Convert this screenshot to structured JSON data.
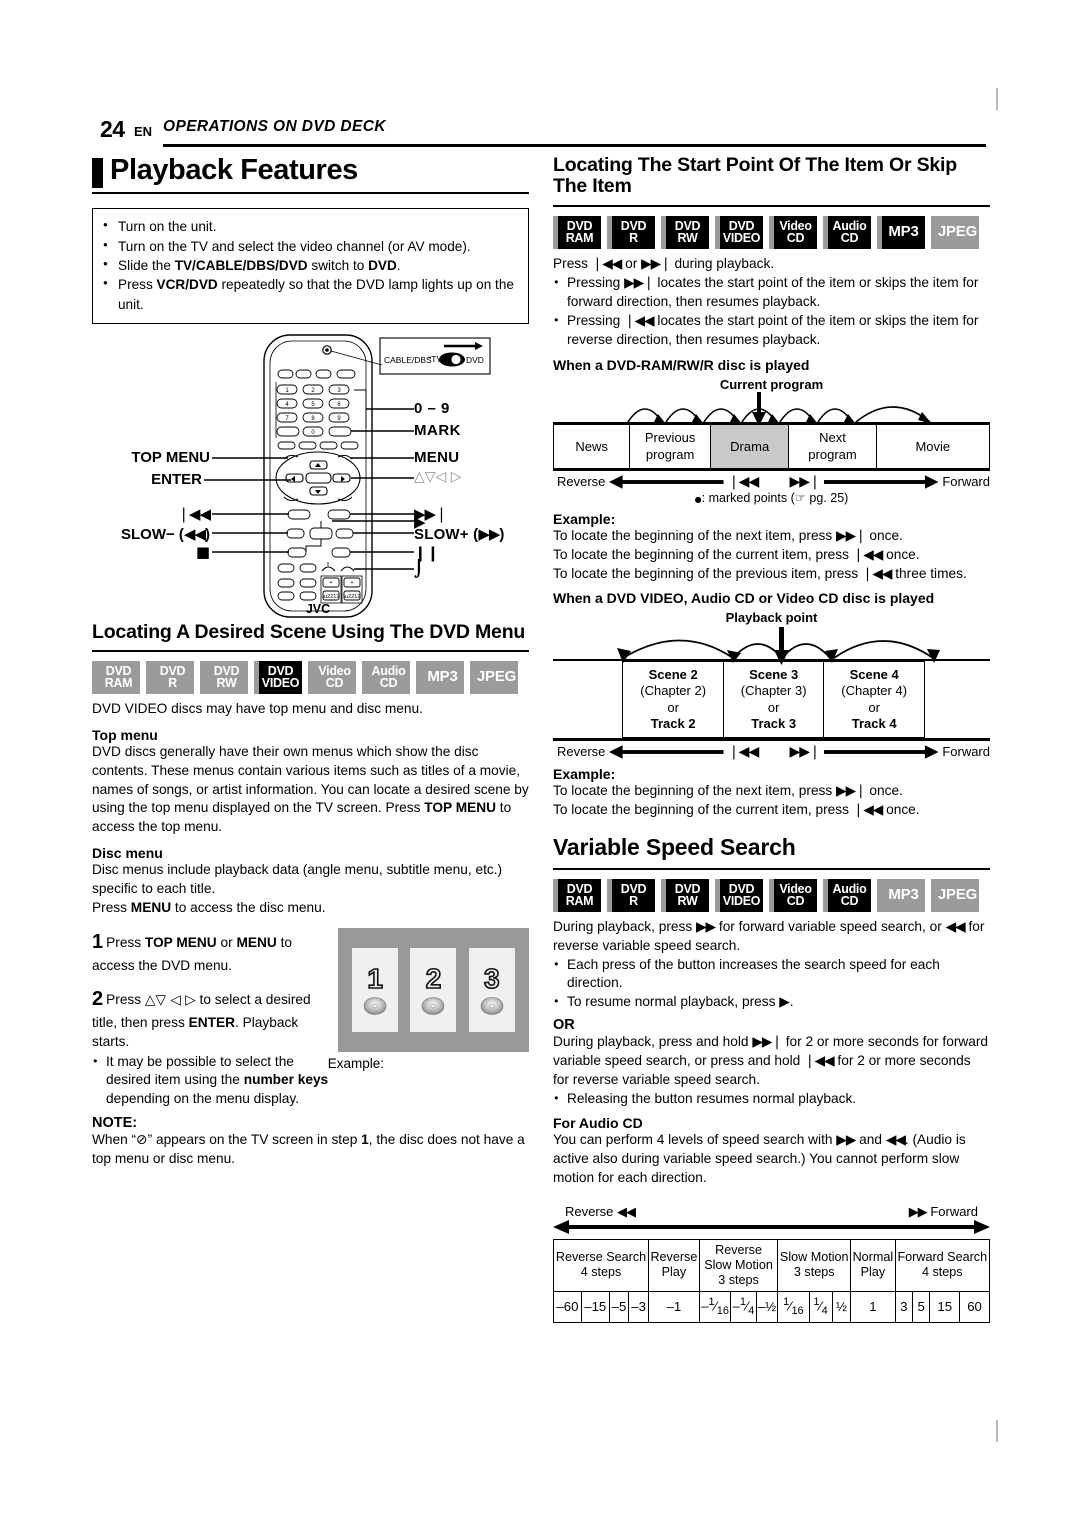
{
  "header": {
    "page_number": "24",
    "lang": "EN",
    "section": "OPERATIONS ON DVD DECK"
  },
  "left": {
    "title": "Playback Features",
    "prep_list": [
      "Turn on the unit.",
      "Turn on the TV and select the video channel (or AV mode).",
      "Slide the TV/CABLE/DBS/DVD switch to DVD.",
      "Press VCR/DVD repeatedly so that the DVD lamp lights up on the unit."
    ],
    "remote": {
      "brand": "JVC",
      "callout_switch": {
        "left": "CABLE/DBS",
        "mid": "TV",
        "right": "DVD"
      },
      "labels_left": [
        "TOP MENU",
        "ENTER",
        "❘◄◄",
        "SLOW− (◄◄◄)",
        "■"
      ],
      "labels_right": [
        "0 – 9",
        "MARK",
        "MENU",
        "△▽ ◁ ▷",
        "►►❘",
        "►",
        "SLOW+ (►►)",
        "❙❙",
        "⌒"
      ]
    },
    "dvd_menu": {
      "heading": "Locating A Desired Scene Using The DVD Menu",
      "badges": [
        {
          "l1": "DVD",
          "l2": "RAM",
          "on": false
        },
        {
          "l1": "DVD",
          "l2": "R",
          "on": false
        },
        {
          "l1": "DVD",
          "l2": "RW",
          "on": false
        },
        {
          "l1": "DVD",
          "l2": "VIDEO",
          "on": true
        },
        {
          "l1": "Video",
          "l2": "CD",
          "on": false
        },
        {
          "l1": "Audio",
          "l2": "CD",
          "on": false
        },
        {
          "l1": "MP3",
          "l2": "",
          "on": false
        },
        {
          "l1": "JPEG",
          "l2": "",
          "on": false
        }
      ],
      "intro": "DVD VIDEO discs may have top menu and disc menu.",
      "topmenu_head": "Top menu",
      "topmenu_body": "DVD discs generally have their own menus which show the disc contents. These menus contain various items such as titles of a movie, names of songs, or artist information. You can locate a desired scene by using the top menu displayed on the TV screen. Press TOP MENU to access the top menu.",
      "discmenu_head": "Disc menu",
      "discmenu_body": "Disc menus include playback data (angle menu, subtitle menu, etc.) specific to each title.",
      "discmenu_body2": "Press MENU to access the disc menu.",
      "step1_num": "1",
      "step1_text": "Press TOP MENU or MENU to access the DVD menu.",
      "step2_num": "2",
      "step2_text": "Press △▽ ◁ ▷ to select a desired title, then press ENTER. Playback starts.",
      "step2_bullet": "It may be possible to select the desired item using the number keys depending on the menu display.",
      "example_caption": "Example:",
      "example_thumbs": [
        "1",
        "2",
        "3"
      ],
      "note_head": "NOTE:",
      "note_body": "When “⊘” appears on the TV screen in step 1, the disc does not have a top menu or disc menu."
    }
  },
  "right": {
    "locating": {
      "heading": "Locating The Start Point Of The Item Or Skip The Item",
      "badges": [
        {
          "l1": "DVD",
          "l2": "RAM",
          "on": true
        },
        {
          "l1": "DVD",
          "l2": "R",
          "on": true
        },
        {
          "l1": "DVD",
          "l2": "RW",
          "on": true
        },
        {
          "l1": "DVD",
          "l2": "VIDEO",
          "on": true
        },
        {
          "l1": "Video",
          "l2": "CD",
          "on": true
        },
        {
          "l1": "Audio",
          "l2": "CD",
          "on": true
        },
        {
          "l1": "MP3",
          "l2": "",
          "on": true
        },
        {
          "l1": "JPEG",
          "l2": "",
          "on": false
        }
      ],
      "intro": "Press ❘◄◄ or ►►❘ during playback.",
      "bullets": [
        "Pressing ►►❘ locates the start point of the item or skips the item for forward direction, then resumes playback.",
        "Pressing ❘◄◄ locates the start point of the item or skips the item for reverse direction, then resumes playback."
      ],
      "ram_head": "When a DVD-RAM/RW/R disc is played",
      "ram_diagram": {
        "caption": "Current program",
        "cells": [
          "News",
          "Previous program",
          "Drama",
          "Next program",
          "Movie"
        ],
        "highlight_index": 2,
        "reverse_label": "Reverse",
        "forward_label": "Forward",
        "skip_back": "❘◄◄",
        "skip_fwd": "►►❘",
        "footnote": "●: marked points (☞ pg. 25)"
      },
      "example_head": "Example:",
      "example_lines": [
        "To locate the beginning of the next item, press ►►❘ once.",
        "To locate the beginning of the current item, press ❘◄◄ once.",
        "To locate the beginning of the previous item, press ❘◄◄ three times."
      ],
      "video_head": "When a DVD VIDEO, Audio CD or Video CD disc is played",
      "video_diagram": {
        "caption": "Playback point",
        "scenes": [
          {
            "scene": "Scene 2",
            "chapter": "(Chapter 2)",
            "or": "or",
            "track": "Track 2"
          },
          {
            "scene": "Scene 3",
            "chapter": "(Chapter 3)",
            "or": "or",
            "track": "Track 3"
          },
          {
            "scene": "Scene 4",
            "chapter": "(Chapter 4)",
            "or": "or",
            "track": "Track 4"
          }
        ],
        "reverse_label": "Reverse",
        "forward_label": "Forward",
        "skip_back": "❘◄◄",
        "skip_fwd": "►►❘"
      },
      "example2_head": "Example:",
      "example2_lines": [
        "To locate the beginning of the next item, press ►►❘ once.",
        "To locate the beginning of the current item, press ❘◄◄ once."
      ]
    },
    "vss": {
      "heading": "Variable Speed Search",
      "badges": [
        {
          "l1": "DVD",
          "l2": "RAM",
          "on": true
        },
        {
          "l1": "DVD",
          "l2": "R",
          "on": true
        },
        {
          "l1": "DVD",
          "l2": "RW",
          "on": true
        },
        {
          "l1": "DVD",
          "l2": "VIDEO",
          "on": true
        },
        {
          "l1": "Video",
          "l2": "CD",
          "on": true
        },
        {
          "l1": "Audio",
          "l2": "CD",
          "on": true
        },
        {
          "l1": "MP3",
          "l2": "",
          "on": false
        },
        {
          "l1": "JPEG",
          "l2": "",
          "on": false
        }
      ],
      "intro": "During playback, press ►► for forward variable speed search, or ◄◄ for reverse variable speed search.",
      "bullets": [
        "Each press of the button increases the search speed for each direction.",
        "To resume normal playback, press ►."
      ],
      "or_head": "OR",
      "or_body": "During playback, press and hold ►►❘ for 2 or more seconds for forward variable speed search, or press and hold ❘◄◄ for 2 or more seconds for reverse variable speed search.",
      "or_bullet": "Releasing the button resumes normal playback.",
      "audio_head": "For Audio CD",
      "audio_body": "You can perform 4 levels of speed search with ►► and ◄◄. (Audio is active also during variable speed search.) You cannot perform slow motion for each direction.",
      "speed_table": {
        "reverse_label": "Reverse",
        "reverse_sym": "◄◄",
        "forward_label": "Forward",
        "forward_sym": "►►",
        "groups": [
          {
            "label": "Reverse Search\n4 steps",
            "span": 4
          },
          {
            "label": "Reverse\nPlay",
            "span": 1
          },
          {
            "label": "Reverse\nSlow Motion\n3 steps",
            "span": 3
          },
          {
            "label": "Slow Motion\n3 steps",
            "span": 3
          },
          {
            "label": "Normal\nPlay",
            "span": 1
          },
          {
            "label": "Forward Search\n4 steps",
            "span": 4
          }
        ],
        "values": [
          "–60",
          "–15",
          "–5",
          "–3",
          "–1",
          "–¹⁄₁₆",
          "–1/4",
          "–½",
          "¹⁄₁₆",
          "1/4",
          "½",
          "1",
          "3",
          "5",
          "15",
          "60"
        ]
      }
    }
  }
}
